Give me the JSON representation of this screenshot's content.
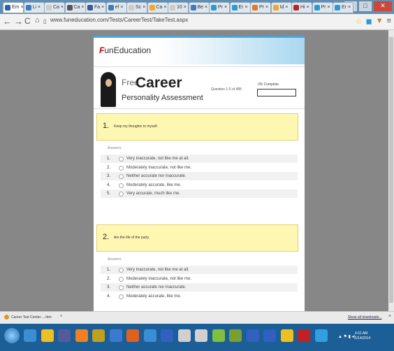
{
  "browser": {
    "tabs": [
      {
        "label": "Em",
        "active": true,
        "color": "#2d5fa8"
      },
      {
        "label": "Li",
        "color": "#3a7cc0"
      },
      {
        "label": "Ca",
        "color": "#cccccc"
      },
      {
        "label": "Ca",
        "color": "#555555"
      },
      {
        "label": "Fa",
        "color": "#3b5998"
      },
      {
        "label": "ef",
        "color": "#3a7cc0"
      },
      {
        "label": "Sc",
        "color": "#cccccc"
      },
      {
        "label": "Ca",
        "color": "#f0a830"
      },
      {
        "label": "10",
        "color": "#cccccc"
      },
      {
        "label": "Be",
        "color": "#3a7cc0"
      },
      {
        "label": "Pr",
        "color": "#2a9ad2"
      },
      {
        "label": "Er",
        "color": "#2a9ad2"
      },
      {
        "label": "Pr",
        "color": "#e07a20"
      },
      {
        "label": "Id",
        "color": "#f0a830"
      },
      {
        "label": "Hi",
        "color": "#c02020"
      },
      {
        "label": "Pr",
        "color": "#2a9ad2"
      },
      {
        "label": "Er",
        "color": "#2a9ad2"
      }
    ],
    "url": "www.funeducation.com/Tests/CareerTest/TakeTest.aspx"
  },
  "page": {
    "logo_fun": "F",
    "logo_rest": "unEducation",
    "title_free": "Free",
    "title_career": "Career",
    "title_sub": "Personality Assessment",
    "question_counter": "Question 1-5 of 485",
    "complete_label": "0% Complete",
    "progress_fraction": 0.0,
    "answers_label": "Answers:",
    "questions": [
      {
        "number": "1.",
        "text": "Keep my thoughts to myself."
      },
      {
        "number": "2.",
        "text": "Am the life of the party."
      }
    ],
    "options": [
      "Very inaccurate, not like me at all.",
      "Moderately inaccurate, not like me.",
      "Neither accurate nor inaccurate.",
      "Moderately accurate, like me.",
      "Very accurate, much like me."
    ],
    "option_numbers": [
      "1.",
      "2.",
      "3.",
      "4.",
      "5."
    ]
  },
  "downloads": {
    "item": "Career Test Center-....htm",
    "show_all": "Show all downloads...",
    "close": "×"
  },
  "taskbar": {
    "time": "4:31 AM",
    "date": "1/14/2014",
    "apps": [
      "#3a8ed6",
      "#f0c020",
      "#555a9a",
      "#f08020",
      "#c0a020",
      "#3b7ad0",
      "#e06020",
      "#3a8ed6",
      "#3060c0",
      "#d0d0d0",
      "#d0d0d0",
      "#80c040",
      "#78a030",
      "#3060c0",
      "#3060c0",
      "#f0c020",
      "#c02020",
      "#30a0e0"
    ]
  }
}
